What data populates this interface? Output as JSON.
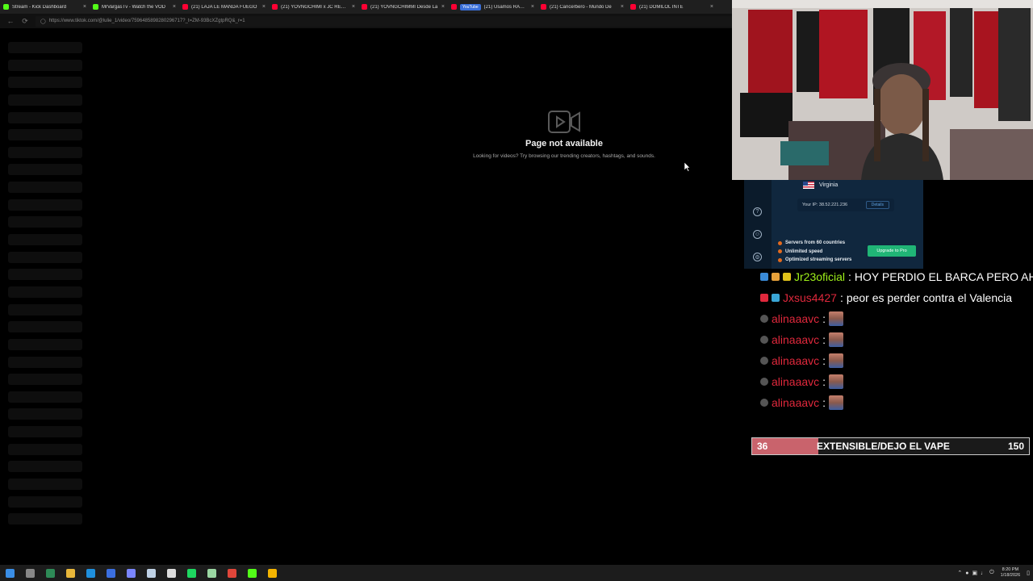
{
  "browser": {
    "tabs": [
      {
        "title": "Stream - Kick Dashboard",
        "favicon_color": "#53fc18"
      },
      {
        "title": "MrVargasTv - Watch the VOD",
        "favicon_color": "#53fc18"
      },
      {
        "title": "(21) LAJA LE MANDA FUEGO",
        "favicon_color": "#ff0033"
      },
      {
        "title": "(21) YOVNGCHIMI x JC REYES",
        "favicon_color": "#ff0033"
      },
      {
        "title": "(21) YOVNGCHIMMI Desde La",
        "favicon_color": "#ff0033"
      },
      {
        "title": "(21) Usamos RANDONAUTICA",
        "favicon_color": "#ff0033",
        "pill": "YouTube"
      },
      {
        "title": "(21) Cancerbero - Mundo De",
        "favicon_color": "#ff0033"
      },
      {
        "title": "(21) DOMILOL INTE",
        "favicon_color": "#ff0033"
      }
    ],
    "url": "https://www.tiktok.com/@lulie_1/video/7596485898280296717?_t=ZM-93BcXZgtpRQ&_r=1"
  },
  "page": {
    "title": "Page not available",
    "description": "Looking for videos? Try browsing our trending creators, hashtags, and sounds.",
    "skeleton_rows": 28
  },
  "vpn": {
    "location": "Virginia",
    "ip_text": "Your IP: 38.52.221.236",
    "details_label": "Details",
    "features": [
      "Servers from 60 countries",
      "Unlimited speed",
      "Optimized streaming servers"
    ],
    "upgrade_label": "Upgrade to Pro",
    "side_icons": [
      "help-icon",
      "account-icon",
      "settings-icon"
    ]
  },
  "chat": {
    "messages": [
      {
        "user": "Jr23oficial",
        "user_color": "#9ef01a",
        "text": "HOY PERDIO EL BARCA PERO AH",
        "badges": [
          "#3a8ad6",
          "#e7a13a",
          "#e0c21a"
        ]
      },
      {
        "user": "Jxsus4427",
        "user_color": "#e0283c",
        "text": "peor es perder contra el Valencia",
        "badges": [
          "#e0283c",
          "#3aa6d6"
        ]
      },
      {
        "user": "alinaaavc",
        "user_color": "#e0283c",
        "text": "",
        "emote": true,
        "badges": [
          "#555555"
        ]
      },
      {
        "user": "alinaaavc",
        "user_color": "#e0283c",
        "text": "",
        "emote": true,
        "badges": [
          "#555555"
        ]
      },
      {
        "user": "alinaaavc",
        "user_color": "#e0283c",
        "text": "",
        "emote": true,
        "badges": [
          "#555555"
        ]
      },
      {
        "user": "alinaaavc",
        "user_color": "#e0283c",
        "text": "",
        "emote": true,
        "badges": [
          "#555555"
        ]
      },
      {
        "user": "alinaaavc",
        "user_color": "#e0283c",
        "text": "",
        "emote": true,
        "badges": [
          "#555555"
        ]
      }
    ]
  },
  "goal": {
    "current": "36",
    "label": "EXTENSIBLE/DEJO EL VAPE",
    "target": "150",
    "progress": 0.24,
    "fill_color": "#c9636c"
  },
  "taskbar": {
    "apps": [
      {
        "name": "windows-start-icon",
        "color": "#3a8ee6"
      },
      {
        "name": "search-icon",
        "color": "#888888"
      },
      {
        "name": "terminal-icon",
        "color": "#2e8b57"
      },
      {
        "name": "file-explorer-icon",
        "color": "#e8b73a"
      },
      {
        "name": "edge-browser-icon",
        "color": "#1f8fdc"
      },
      {
        "name": "store-icon",
        "color": "#3b6fe0"
      },
      {
        "name": "discord-icon",
        "color": "#7a86ff"
      },
      {
        "name": "steam-icon",
        "color": "#c0d2e6"
      },
      {
        "name": "capcut-icon",
        "color": "#dddddd"
      },
      {
        "name": "spotify-icon",
        "color": "#1ed760"
      },
      {
        "name": "obs-icon",
        "color": "#9bd7a3"
      },
      {
        "name": "chrome-icon",
        "color": "#e0463a"
      },
      {
        "name": "kick-icon",
        "color": "#53fc18"
      },
      {
        "name": "chrome-alt-icon",
        "color": "#f4b400"
      }
    ],
    "time": "8:20 PM",
    "date": "1/18/2026"
  }
}
